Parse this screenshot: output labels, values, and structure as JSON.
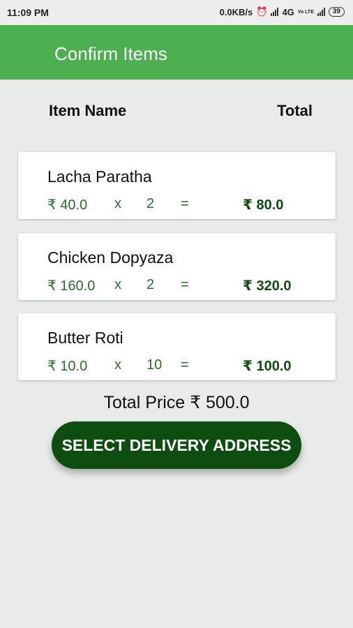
{
  "status_bar": {
    "time": "11:09 PM",
    "speed": "0.0KB/s",
    "network": "4G",
    "volte": "Vo LTE",
    "battery": "39"
  },
  "app_bar": {
    "title": "Confirm Items"
  },
  "table_header": {
    "name": "Item Name",
    "total": "Total"
  },
  "items": [
    {
      "name": "Lacha Paratha",
      "price": "₹ 40.0",
      "times": "x",
      "qty": "2",
      "equals": "=",
      "total": "₹ 80.0"
    },
    {
      "name": "Chicken Dopyaza",
      "price": "₹ 160.0",
      "times": "x",
      "qty": "2",
      "equals": "=",
      "total": "₹ 320.0"
    },
    {
      "name": "Butter Roti",
      "price": "₹ 10.0",
      "times": "x",
      "qty": "10",
      "equals": "=",
      "total": "₹ 100.0"
    }
  ],
  "total_price": "Total Price ₹ 500.0",
  "cta_label": "SELECT DELIVERY ADDRESS",
  "colors": {
    "app_bar": "#4caf50",
    "accent_dark": "#0d4d10",
    "price_text": "#2e6b2e",
    "background": "#e8ebe8"
  }
}
